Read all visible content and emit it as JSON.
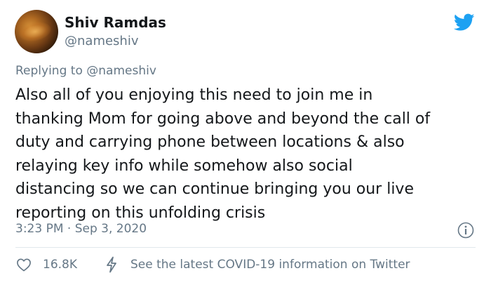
{
  "author": {
    "name": "Shiv Ramdas",
    "handle": "@nameshiv"
  },
  "reply": {
    "prefix": "Replying to ",
    "mention": "@nameshiv"
  },
  "tweet": {
    "text": "Also all of you enjoying this need to join me in\nthanking Mom for going above and beyond the call of\nduty and carrying phone between locations & also\nrelaying key info while somehow also social\ndistancing so we can continue bringing you our live\nreporting on this unfolding crisis",
    "timestamp": "3:23 PM · Sep 3, 2020"
  },
  "footer": {
    "likes": "16.8K",
    "covid_link": "See the latest COVID-19 information on Twitter"
  },
  "colors": {
    "brand": "#1da1f2",
    "muted": "#657786",
    "text": "#14171a"
  },
  "icons": {
    "logo": "twitter-bird-icon",
    "info": "info-icon",
    "like": "heart-icon",
    "covid": "lightning-bolt-icon"
  }
}
